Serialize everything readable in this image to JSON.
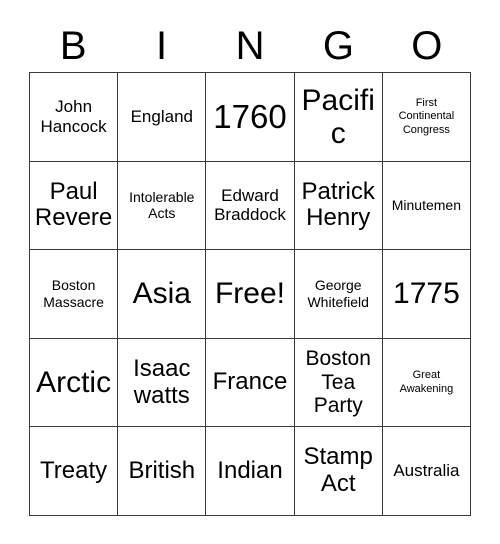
{
  "card": {
    "title_letters": [
      "B",
      "I",
      "N",
      "G",
      "O"
    ],
    "free_space_label": "Free!",
    "border_color": "#3a3a3a",
    "background_color": "#ffffff",
    "text_color": "#000000",
    "columns": 5,
    "rows": 5,
    "rows_data": [
      [
        {
          "text": "John\nHancock",
          "size": "md"
        },
        {
          "text": "England",
          "size": "md"
        },
        {
          "text": "1760",
          "size": "huge"
        },
        {
          "text": "Pacific",
          "size": "xxl"
        },
        {
          "text": "First\nContinental\nCongress",
          "size": "xs"
        }
      ],
      [
        {
          "text": "Paul\nRevere",
          "size": "xl"
        },
        {
          "text": "Intolerable\nActs",
          "size": "sm"
        },
        {
          "text": "Edward\nBraddock",
          "size": "md"
        },
        {
          "text": "Patrick\nHenry",
          "size": "xl"
        },
        {
          "text": "Minutemen",
          "size": "sm"
        }
      ],
      [
        {
          "text": "Boston\nMassacre",
          "size": "sm"
        },
        {
          "text": "Asia",
          "size": "xxl"
        },
        {
          "text": "Free!",
          "size": "xxl"
        },
        {
          "text": "George\nWhitefield",
          "size": "sm"
        },
        {
          "text": "1775",
          "size": "xxl"
        }
      ],
      [
        {
          "text": "Arctic",
          "size": "xxl"
        },
        {
          "text": "Isaac\nwatts",
          "size": "xl"
        },
        {
          "text": "France",
          "size": "xl"
        },
        {
          "text": "Boston\nTea\nParty",
          "size": "lg"
        },
        {
          "text": "Great\nAwakening",
          "size": "xs"
        }
      ],
      [
        {
          "text": "Treaty",
          "size": "xl"
        },
        {
          "text": "British",
          "size": "xl"
        },
        {
          "text": "Indian",
          "size": "xl"
        },
        {
          "text": "Stamp\nAct",
          "size": "xl"
        },
        {
          "text": "Australia",
          "size": "md"
        }
      ]
    ]
  }
}
